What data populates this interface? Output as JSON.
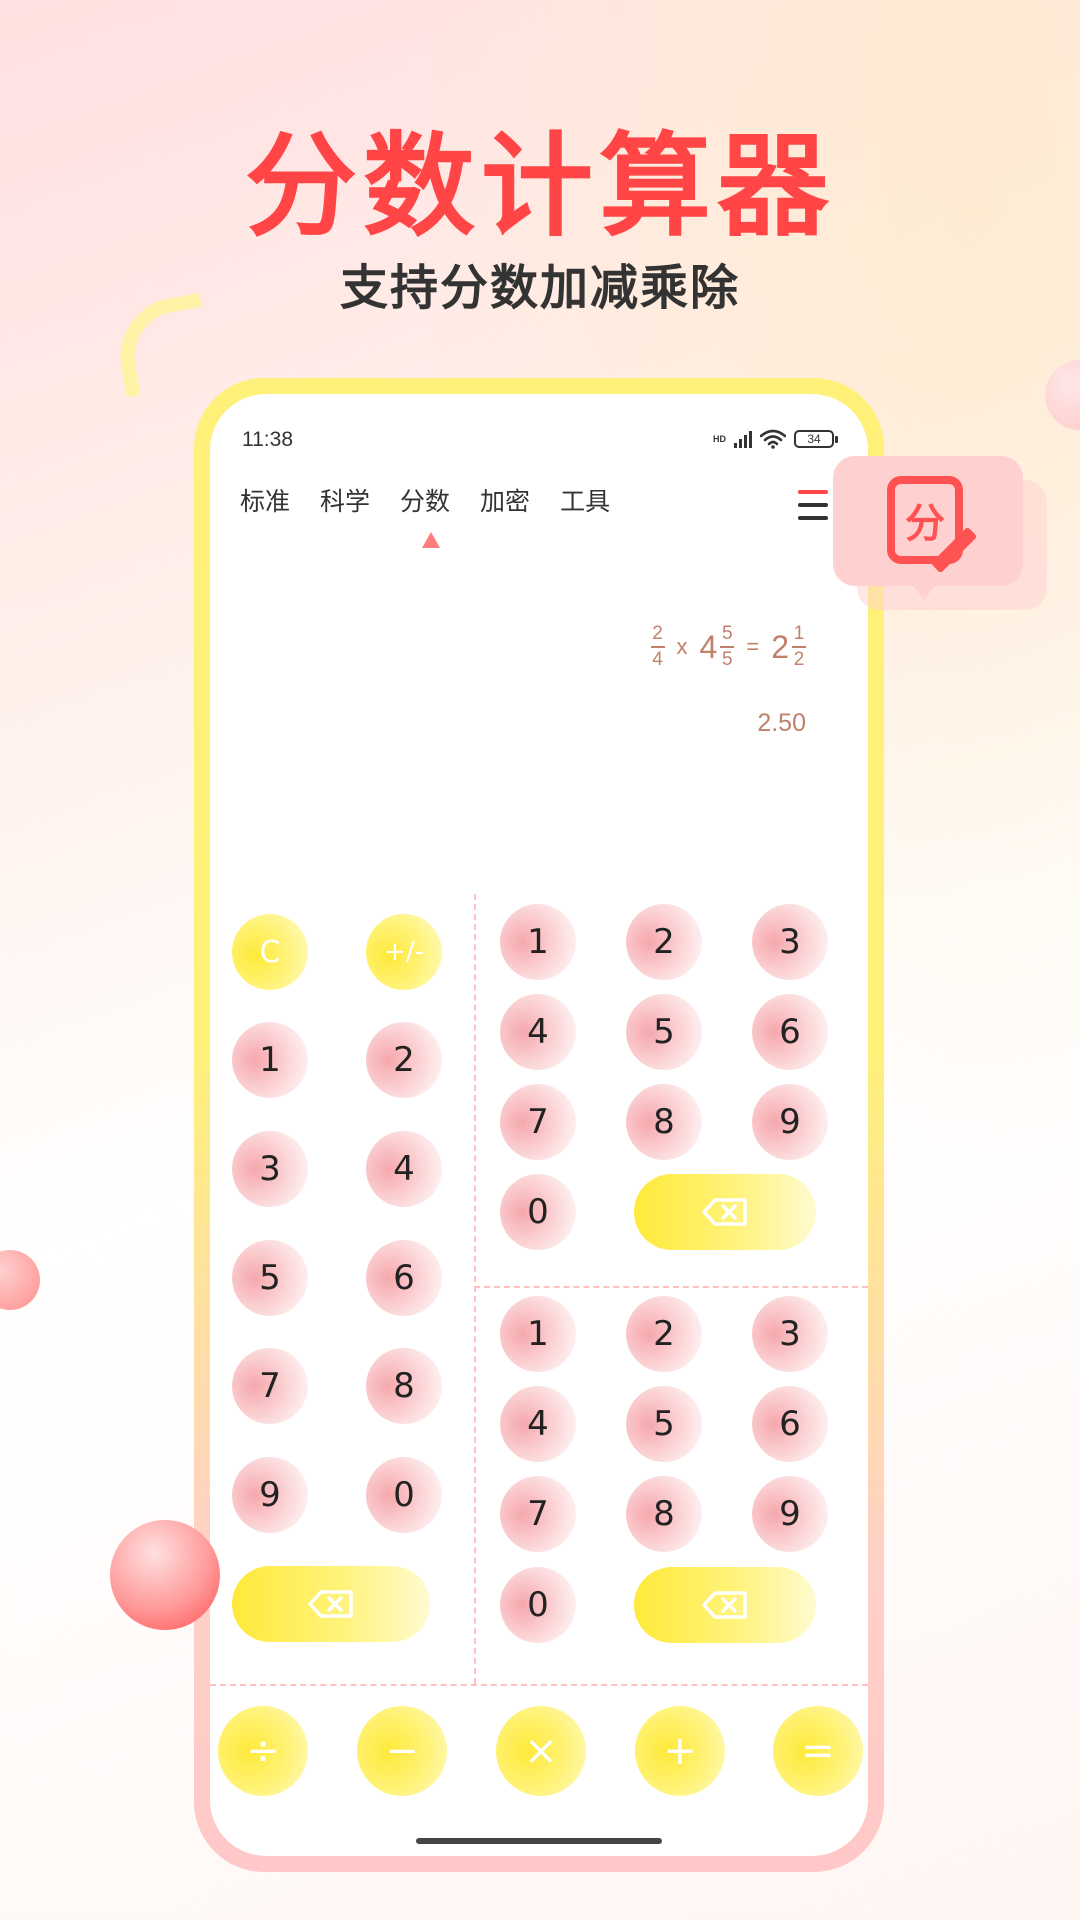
{
  "headline": "分数计算器",
  "subline": "支持分数加减乘除",
  "status_bar": {
    "time": "11:38",
    "network": "HD",
    "battery": "34"
  },
  "tabs": [
    {
      "label": "标准"
    },
    {
      "label": "科学"
    },
    {
      "label": "分数",
      "active": true
    },
    {
      "label": "加密"
    },
    {
      "label": "工具"
    }
  ],
  "display": {
    "operand1": {
      "numerator": "2",
      "denominator": "4"
    },
    "operator": "x",
    "operand2": {
      "whole": "4",
      "numerator": "5",
      "denominator": "5"
    },
    "equals": "=",
    "result": {
      "whole": "2",
      "numerator": "1",
      "denominator": "2"
    },
    "decimal": "2.50"
  },
  "left_pad": {
    "clear": "C",
    "sign": "+/-",
    "digits": [
      "1",
      "2",
      "3",
      "4",
      "5",
      "6",
      "7",
      "8",
      "9",
      "0"
    ]
  },
  "numerator_pad": {
    "digits": [
      "1",
      "2",
      "3",
      "4",
      "5",
      "6",
      "7",
      "8",
      "9",
      "0"
    ]
  },
  "denominator_pad": {
    "digits": [
      "1",
      "2",
      "3",
      "4",
      "5",
      "6",
      "7",
      "8",
      "9",
      "0"
    ]
  },
  "operators": [
    "÷",
    "−",
    "×",
    "+",
    "="
  ],
  "badge": {
    "glyph": "分"
  },
  "colors": {
    "accent": "#ff4545",
    "key_pink": "#f5a8ad",
    "key_yellow": "#ffe93a",
    "phone_frame_top": "#fff07a",
    "phone_frame_bottom": "#ffc8c8",
    "result_text": "#c0806a"
  }
}
